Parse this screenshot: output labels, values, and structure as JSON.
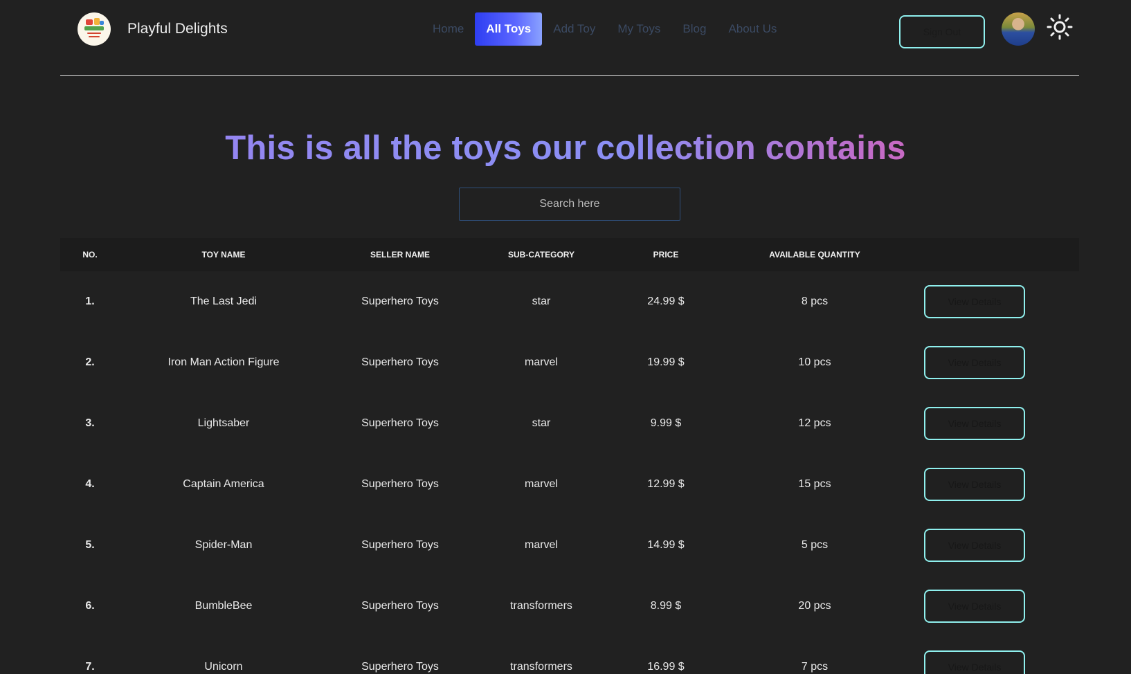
{
  "brand": {
    "name": "Playful Delights"
  },
  "nav": {
    "links": [
      {
        "label": "Home"
      },
      {
        "label": "All Toys",
        "active": true
      },
      {
        "label": "Add Toy"
      },
      {
        "label": "My Toys"
      },
      {
        "label": "Blog"
      },
      {
        "label": "About Us"
      }
    ],
    "signout_label": "Sign Out",
    "theme_icon": "sun-icon"
  },
  "hero": {
    "title": "This is all the toys our collection contains",
    "search_placeholder": "Search here"
  },
  "table": {
    "headers": [
      "NO.",
      "TOY NAME",
      "SELLER NAME",
      "SUB-CATEGORY",
      "PRICE",
      "AVAILABLE QUANTITY"
    ],
    "action_label": "View Details",
    "rows": [
      {
        "no": "1.",
        "name": "The Last Jedi",
        "seller": "Superhero Toys",
        "sub": "star",
        "price": "24.99 $",
        "qty": "8 pcs"
      },
      {
        "no": "2.",
        "name": "Iron Man Action Figure",
        "seller": "Superhero Toys",
        "sub": "marvel",
        "price": "19.99 $",
        "qty": "10 pcs"
      },
      {
        "no": "3.",
        "name": "Lightsaber",
        "seller": "Superhero Toys",
        "sub": "star",
        "price": "9.99 $",
        "qty": "12 pcs"
      },
      {
        "no": "4.",
        "name": "Captain America",
        "seller": "Superhero Toys",
        "sub": "marvel",
        "price": "12.99 $",
        "qty": "15 pcs"
      },
      {
        "no": "5.",
        "name": "Spider-Man",
        "seller": "Superhero Toys",
        "sub": "marvel",
        "price": "14.99 $",
        "qty": "5 pcs"
      },
      {
        "no": "6.",
        "name": "BumbleBee",
        "seller": "Superhero Toys",
        "sub": "transformers",
        "price": "8.99 $",
        "qty": "20 pcs"
      },
      {
        "no": "7.",
        "name": "Unicorn",
        "seller": "Superhero Toys",
        "sub": "transformers",
        "price": "16.99 $",
        "qty": "7 pcs"
      }
    ]
  },
  "colors": {
    "background": "#212121",
    "accent_outline": "#8ff0ee",
    "active_nav": "#3b49f5"
  }
}
